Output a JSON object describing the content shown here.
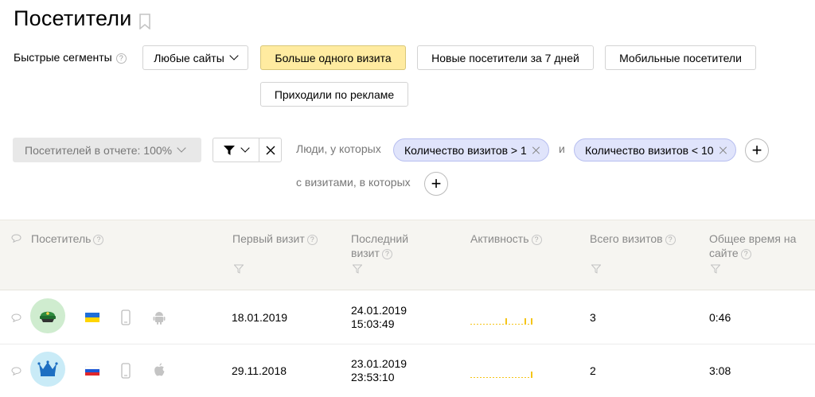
{
  "page": {
    "title": "Посетители"
  },
  "segments": {
    "label": "Быстрые сегменты",
    "help": "?",
    "any_sites": "Любые сайты",
    "buttons": [
      "Больше одного визита",
      "Новые посетители за 7 дней",
      "Мобильные посетители",
      "Приходили по рекламе"
    ],
    "active_index": 0
  },
  "filter": {
    "percent_label": "Посетителей в отчете: 100%",
    "people_label": "Люди, у которых",
    "conditions": [
      "Количество визитов > 1",
      "Количество визитов < 10"
    ],
    "conjunction": "и",
    "visits_label": "с визитами, в которых"
  },
  "table": {
    "columns": {
      "visitor": "Посетитель",
      "first_visit": "Первый визит",
      "last_visit_line1": "Последний",
      "last_visit_line2": "визит",
      "activity": "Активность",
      "total_visits": "Всего визитов",
      "total_time_line1": "Общее время на",
      "total_time_line2": "сайте"
    },
    "rows": [
      {
        "avatar_icon": "captain-hat-icon",
        "flag": "ukraine-flag-icon",
        "device": "phone-icon",
        "os": "android-icon",
        "first_visit": "18.01.2019",
        "last_visit_date": "24.01.2019",
        "last_visit_time": "15:03:49",
        "activity": [
          0,
          0,
          0,
          0,
          0,
          0,
          0,
          0,
          0,
          0,
          0,
          1,
          0,
          0,
          0,
          0,
          0,
          1,
          0,
          1
        ],
        "total_visits": "3",
        "total_time": "0:46"
      },
      {
        "avatar_icon": "crown-icon",
        "flag": "russia-flag-icon",
        "device": "phone-icon",
        "os": "apple-icon",
        "first_visit": "29.11.2018",
        "last_visit_date": "23.01.2019",
        "last_visit_time": "23:53:10",
        "activity": [
          0,
          0,
          0,
          0,
          0,
          0,
          0,
          0,
          0,
          0,
          0,
          0,
          0,
          0,
          0,
          0,
          0,
          0,
          0,
          1
        ],
        "total_visits": "2",
        "total_time": "3:08"
      }
    ]
  },
  "colors": {
    "active_segment": "#ffeba0",
    "chip_bg": "#e0e4fb",
    "activity_bar": "#f5c518",
    "avatar_green": "#cfeccf",
    "avatar_blue": "#c9ebf7"
  }
}
